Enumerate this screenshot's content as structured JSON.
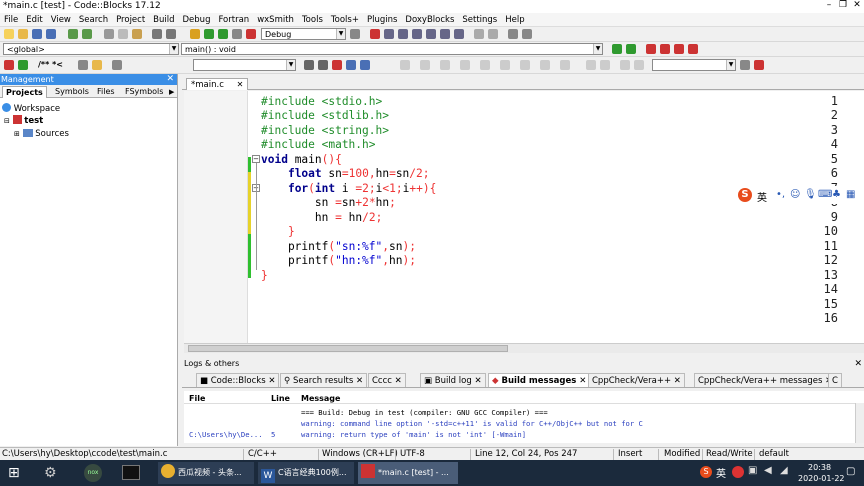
{
  "window": {
    "title": "*main.c [test] - Code::Blocks 17.12"
  },
  "menu": [
    "File",
    "Edit",
    "View",
    "Search",
    "Project",
    "Build",
    "Debug",
    "Fortran",
    "wxSmith",
    "Tools",
    "Tools+",
    "Plugins",
    "DoxyBlocks",
    "Settings",
    "Help"
  ],
  "toolbar": {
    "build_target": "Debug",
    "scope": "<global>",
    "function": "main() : void",
    "comment_label": "/** *<"
  },
  "management": {
    "title": "Management",
    "tabs": [
      "Projects",
      "Symbols",
      "Files",
      "FSymbols"
    ],
    "tree": {
      "workspace": "Workspace",
      "project": "test",
      "folder": "Sources"
    }
  },
  "editor": {
    "tab_label": "*main.c",
    "line_numbers": [
      "1",
      "2",
      "3",
      "4",
      "5",
      "6",
      "7",
      "8",
      "9",
      "10",
      "11",
      "12",
      "13",
      "14",
      "15",
      "16"
    ]
  },
  "logs": {
    "title": "Logs & others",
    "tabs": [
      "Code::Blocks",
      "Search results",
      "Cccc",
      "Build log",
      "Build messages",
      "CppCheck/Vera++",
      "CppCheck/Vera++ messages",
      "C"
    ],
    "columns": [
      "File",
      "Line",
      "Message"
    ],
    "rows": [
      {
        "file": "",
        "line": "",
        "message": "=== Build: Debug in test (compiler: GNU GCC Compiler) ==="
      },
      {
        "file": "",
        "line": "",
        "message": "warning: command line option '-std=c++11' is valid for C++/ObjC++ but not for C"
      },
      {
        "file": "C:\\Users\\hy\\De...",
        "line": "5",
        "message": "warning: return type of 'main' is not 'int' [-Wmain]"
      }
    ]
  },
  "status": {
    "path": "C:\\Users\\hy\\Desktop\\ccode\\test\\main.c",
    "language": "C/C++",
    "eol": "Windows (CR+LF)",
    "encoding": "UTF-8",
    "position": "Line 12, Col 24, Pos 247",
    "mode": "Insert",
    "modified": "Modified",
    "access": "Read/Write",
    "profile": "default"
  },
  "taskbar": {
    "items": [
      "西瓜视频 - 头条...",
      "C语言经典100例...",
      "*main.c [test] - ..."
    ],
    "time": "20:38",
    "date": "2020-01-22"
  },
  "ime": {
    "label": "英"
  },
  "colors": {
    "keyword": "#00008b",
    "preprocessor": "#1f8c2a",
    "number": "#e33",
    "string": "#0000d0",
    "accent": "#3a8ee6"
  }
}
